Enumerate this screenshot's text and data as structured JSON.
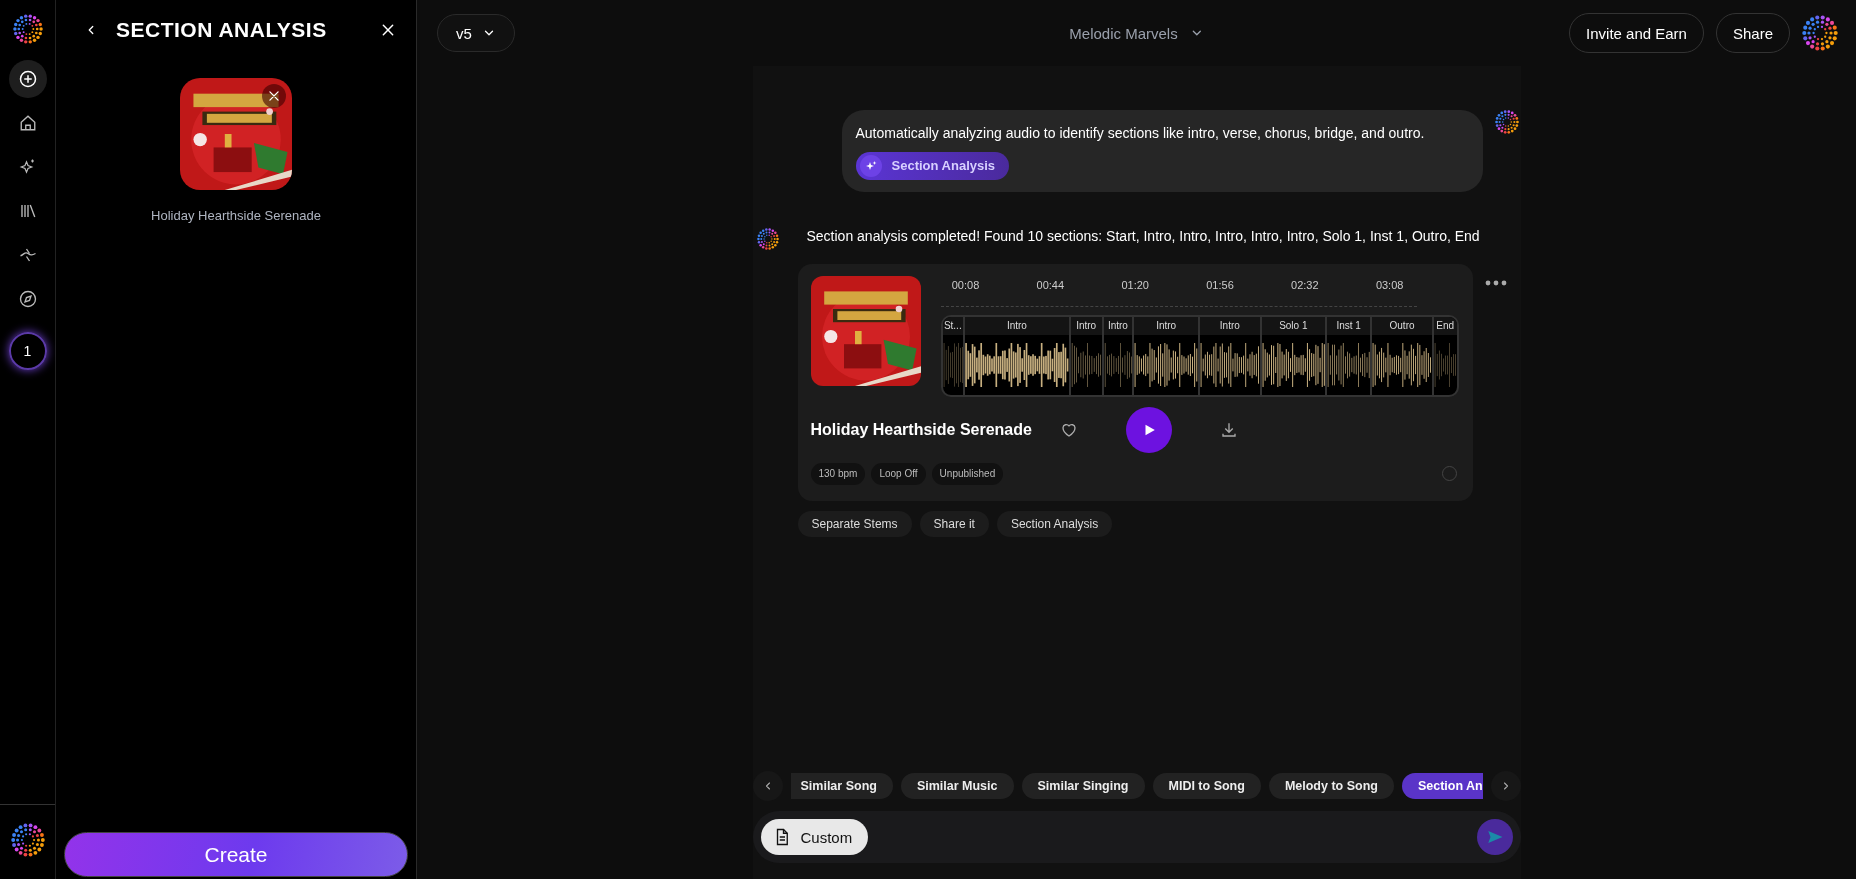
{
  "rail": {
    "items": [
      {
        "kind": "create",
        "selected": true
      },
      {
        "kind": "home",
        "selected": false
      },
      {
        "kind": "sparkle",
        "selected": false
      },
      {
        "kind": "library",
        "selected": false
      },
      {
        "kind": "wave",
        "selected": false
      },
      {
        "kind": "explore",
        "selected": false
      }
    ],
    "badge": "1"
  },
  "panel": {
    "title": "SECTION ANALYSIS",
    "song_title": "Holiday Hearthside Serenade",
    "create_button": "Create"
  },
  "topbar": {
    "model": "v5",
    "project": "Melodic Marvels",
    "buttons": [
      "Invite and Earn",
      "Share"
    ]
  },
  "chat": {
    "user_message": {
      "text": "Automatically analyzing audio to identify sections like intro, verse, chorus, bridge, and outro.",
      "tool": "Section Analysis"
    },
    "reply": "Section analysis completed! Found 10 sections: Start, Intro, Intro, Intro, Intro, Intro, Solo 1, Inst 1, Outro, End",
    "track": {
      "title": "Holiday Hearthside Serenade",
      "timeline": [
        "00:08",
        "00:44",
        "01:20",
        "01:56",
        "02:32",
        "03:08"
      ],
      "sections": [
        "St...",
        "Intro",
        "Intro",
        "Intro",
        "Intro",
        "Intro",
        "Solo 1",
        "Inst 1",
        "Outro",
        "End"
      ],
      "tags": [
        "130 bpm",
        "Loop Off",
        "Unpublished"
      ],
      "liked": false
    },
    "actions": [
      "Separate Stems",
      "Share it",
      "Section Analysis"
    ]
  },
  "tools": [
    {
      "label": "Similar Song",
      "selected": false
    },
    {
      "label": "Similar Music",
      "selected": false
    },
    {
      "label": "Similar Singing",
      "selected": false
    },
    {
      "label": "MIDI to Song",
      "selected": false
    },
    {
      "label": "Melody to Song",
      "selected": false
    },
    {
      "label": "Section An",
      "selected": true
    }
  ],
  "composer": {
    "mode": "Custom"
  }
}
